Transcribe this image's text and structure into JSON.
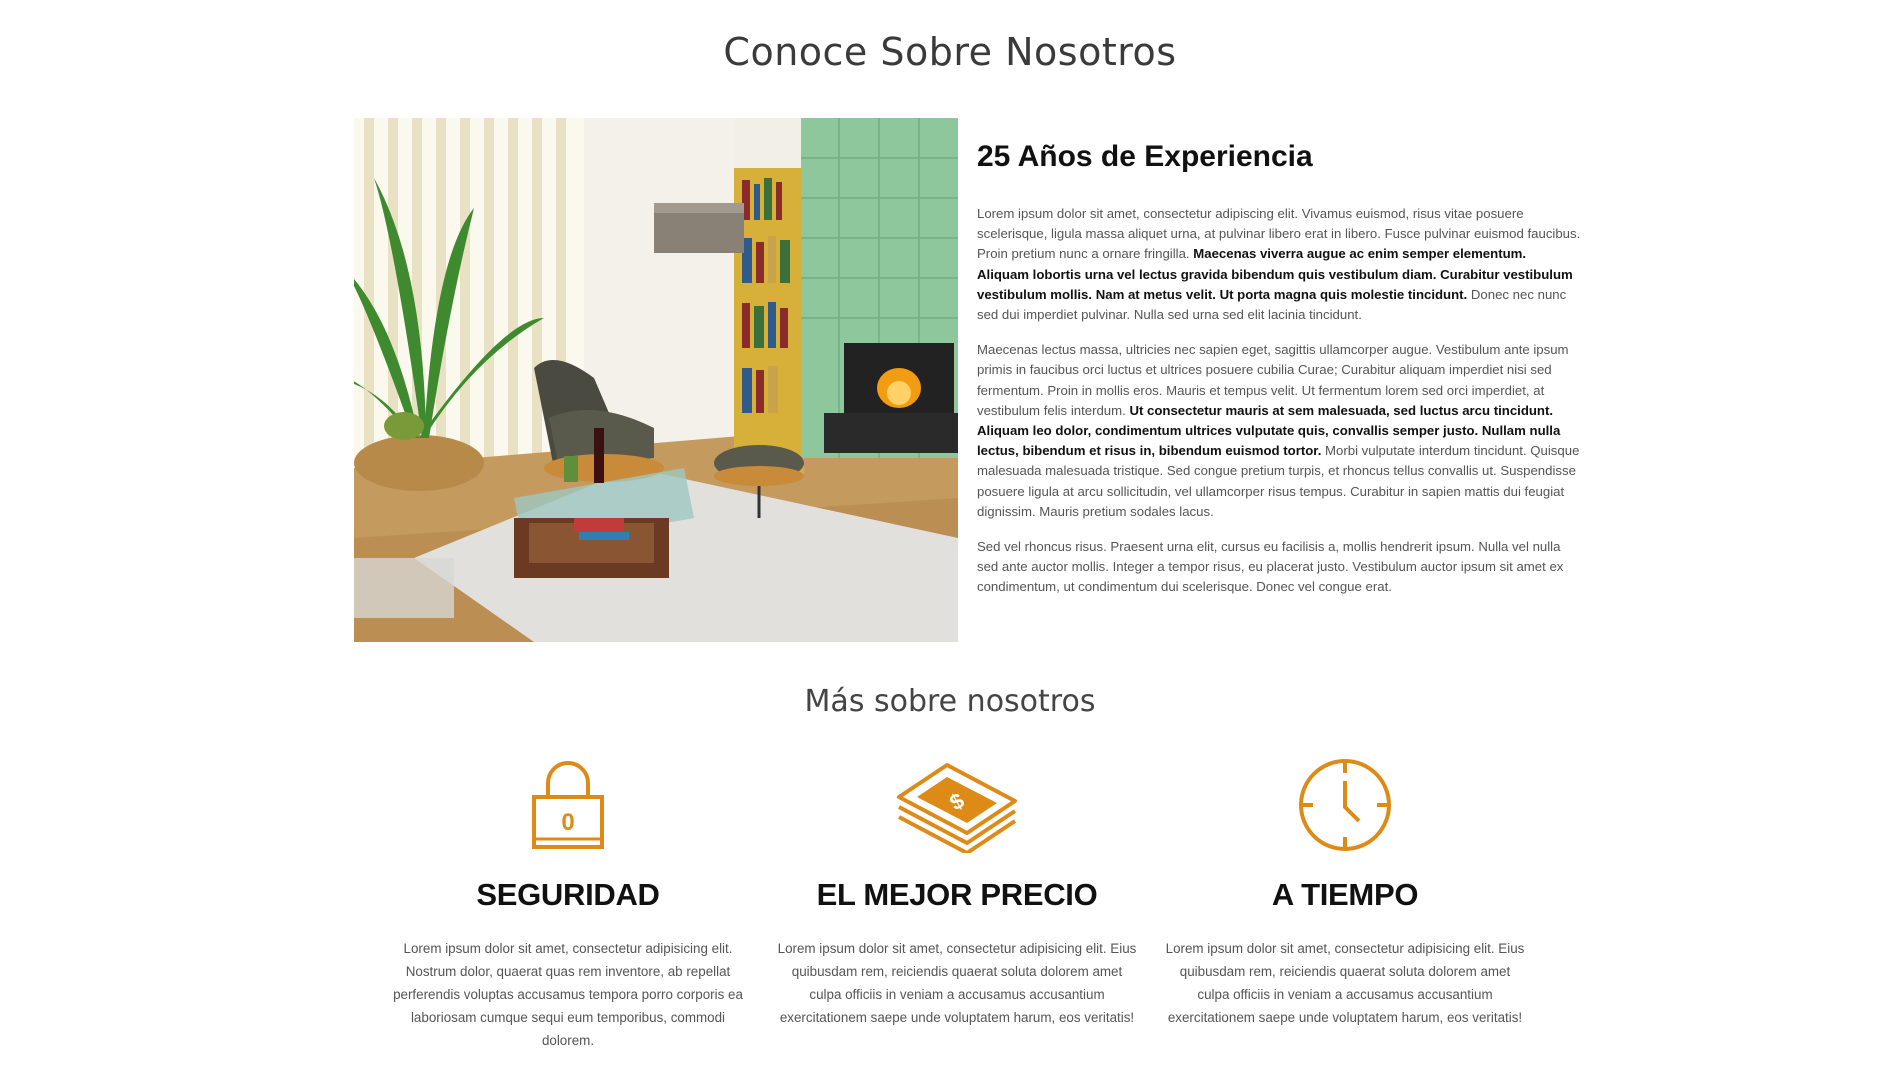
{
  "colors": {
    "accent": "#de8a17",
    "heading": "#111111",
    "body": "#555555"
  },
  "main_title": "Conoce Sobre Nosotros",
  "about": {
    "heading": "25 Años de Experiencia",
    "p1_a": "Lorem ipsum dolor sit amet, consectetur adipiscing elit. Vivamus euismod, risus vitae posuere scelerisque, ligula massa aliquet urna, at pulvinar libero erat in libero. Fusce pulvinar euismod faucibus. Proin pretium nunc a ornare fringilla. ",
    "p1_b": "Maecenas viverra augue ac enim semper elementum. Aliquam lobortis urna vel lectus gravida bibendum quis vestibulum diam. Curabitur vestibulum vestibulum mollis. Nam at metus velit. Ut porta magna quis molestie tincidunt.",
    "p1_c": " Donec nec nunc sed dui imperdiet pulvinar. Nulla sed urna sed elit lacinia tincidunt.",
    "p2_a": "Maecenas lectus massa, ultricies nec sapien eget, sagittis ullamcorper augue. Vestibulum ante ipsum primis in faucibus orci luctus et ultrices posuere cubilia Curae; Curabitur aliquam imperdiet nisi sed fermentum. Proin in mollis eros. Mauris et tempus velit. Ut fermentum lorem sed orci imperdiet, at vestibulum felis interdum. ",
    "p2_b": "Ut consectetur mauris at sem malesuada, sed luctus arcu tincidunt. Aliquam leo dolor, condimentum ultrices vulputate quis, convallis semper justo. Nullam nulla lectus, bibendum et risus in, bibendum euismod tortor.",
    "p2_c": " Morbi vulputate interdum tincidunt. Quisque malesuada malesuada tristique. Sed congue pretium turpis, et rhoncus tellus convallis ut. Suspendisse posuere ligula at arcu sollicitudin, vel ullamcorper risus tempus. Curabitur in sapien mattis dui feugiat dignissim. Mauris pretium sodales lacus.",
    "p3": "Sed vel rhoncus risus. Praesent urna elit, cursus eu facilisis a, mollis hendrerit ipsum. Nulla vel nulla sed ante auctor mollis. Integer a tempor risus, eu placerat justo. Vestibulum auctor ipsum sit amet ex condimentum, ut condimentum dui scelerisque. Donec vel congue erat."
  },
  "more_title": "Más sobre nosotros",
  "features": [
    {
      "icon": "padlock-icon",
      "lock_digit": "0",
      "title": "SEGURIDAD",
      "text": "Lorem ipsum dolor sit amet, consectetur adipisicing elit. Nostrum dolor, quaerat quas rem inventore, ab repellat perferendis voluptas accusamus tempora porro corporis ea laboriosam cumque sequi eum temporibus, commodi dolorem."
    },
    {
      "icon": "money-stack-icon",
      "money_symbol": "$",
      "title": "EL MEJOR PRECIO",
      "text": "Lorem ipsum dolor sit amet, consectetur adipisicing elit. Eius quibusdam rem, reiciendis quaerat soluta dolorem amet culpa officiis in veniam a accusamus accusantium exercitationem saepe unde voluptatem harum, eos veritatis!"
    },
    {
      "icon": "clock-icon",
      "title": "A TIEMPO",
      "text": "Lorem ipsum dolor sit amet, consectetur adipisicing elit. Eius quibusdam rem, reiciendis quaerat soluta dolorem amet culpa officiis in veniam a accusamus accusantium exercitationem saepe unde voluptatem harum, eos veritatis!"
    }
  ]
}
